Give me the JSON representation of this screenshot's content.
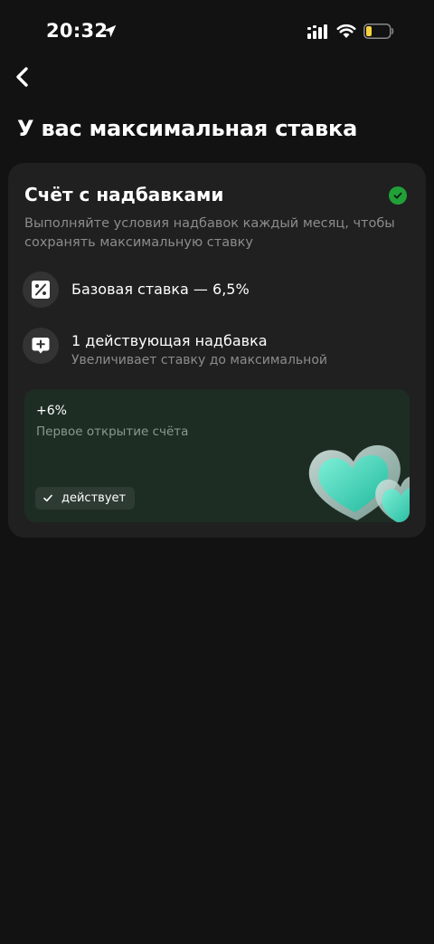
{
  "status_bar": {
    "time": "20:32",
    "icons": [
      "location-arrow-icon",
      "signal-icon",
      "wifi-icon",
      "battery-icon"
    ],
    "battery_color": "#f5d33f"
  },
  "header": {
    "back_icon": "chevron-left-icon",
    "title": "У вас максимальная ставка"
  },
  "card": {
    "title": "Счёт с надбавками",
    "check_icon": "check-circle-icon",
    "check_color": "#21a038",
    "description": "Выполняйте условия надбавок каждый месяц, чтобы сохранять максимальную ставку",
    "features": [
      {
        "icon": "percent-icon",
        "title": "Базовая ставка — 6,5%"
      },
      {
        "icon": "plus-message-icon",
        "title": "1 действующая надбавка",
        "subtitle": "Увеличивает ставку до максимальной"
      }
    ],
    "bonus": {
      "value": "+6%",
      "description": "Первое открытие счёта",
      "status_label": "действует",
      "illustration": "hearts-illustration"
    }
  },
  "colors": {
    "background": "#121212",
    "card": "#202020",
    "bonus_card": "#1e2d24",
    "accent": "#21a038"
  }
}
